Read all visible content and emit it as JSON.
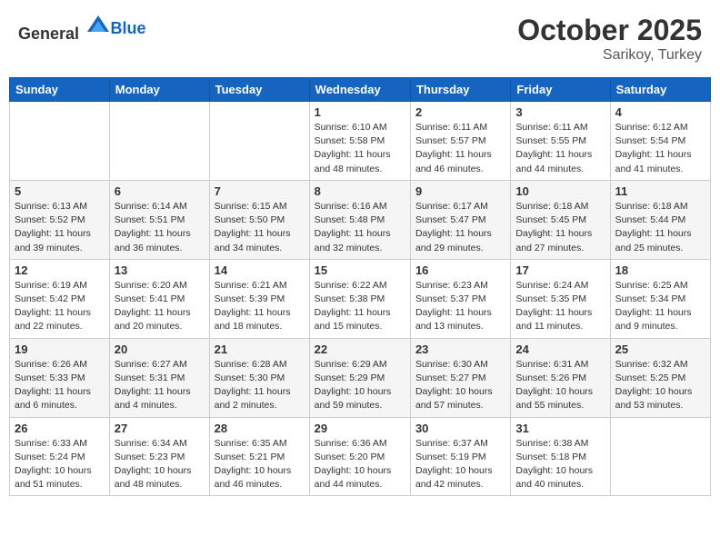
{
  "header": {
    "logo_general": "General",
    "logo_blue": "Blue",
    "month": "October 2025",
    "location": "Sarikoy, Turkey"
  },
  "days_of_week": [
    "Sunday",
    "Monday",
    "Tuesday",
    "Wednesday",
    "Thursday",
    "Friday",
    "Saturday"
  ],
  "weeks": [
    [
      {
        "day": "",
        "info": ""
      },
      {
        "day": "",
        "info": ""
      },
      {
        "day": "",
        "info": ""
      },
      {
        "day": "1",
        "info": "Sunrise: 6:10 AM\nSunset: 5:58 PM\nDaylight: 11 hours\nand 48 minutes."
      },
      {
        "day": "2",
        "info": "Sunrise: 6:11 AM\nSunset: 5:57 PM\nDaylight: 11 hours\nand 46 minutes."
      },
      {
        "day": "3",
        "info": "Sunrise: 6:11 AM\nSunset: 5:55 PM\nDaylight: 11 hours\nand 44 minutes."
      },
      {
        "day": "4",
        "info": "Sunrise: 6:12 AM\nSunset: 5:54 PM\nDaylight: 11 hours\nand 41 minutes."
      }
    ],
    [
      {
        "day": "5",
        "info": "Sunrise: 6:13 AM\nSunset: 5:52 PM\nDaylight: 11 hours\nand 39 minutes."
      },
      {
        "day": "6",
        "info": "Sunrise: 6:14 AM\nSunset: 5:51 PM\nDaylight: 11 hours\nand 36 minutes."
      },
      {
        "day": "7",
        "info": "Sunrise: 6:15 AM\nSunset: 5:50 PM\nDaylight: 11 hours\nand 34 minutes."
      },
      {
        "day": "8",
        "info": "Sunrise: 6:16 AM\nSunset: 5:48 PM\nDaylight: 11 hours\nand 32 minutes."
      },
      {
        "day": "9",
        "info": "Sunrise: 6:17 AM\nSunset: 5:47 PM\nDaylight: 11 hours\nand 29 minutes."
      },
      {
        "day": "10",
        "info": "Sunrise: 6:18 AM\nSunset: 5:45 PM\nDaylight: 11 hours\nand 27 minutes."
      },
      {
        "day": "11",
        "info": "Sunrise: 6:18 AM\nSunset: 5:44 PM\nDaylight: 11 hours\nand 25 minutes."
      }
    ],
    [
      {
        "day": "12",
        "info": "Sunrise: 6:19 AM\nSunset: 5:42 PM\nDaylight: 11 hours\nand 22 minutes."
      },
      {
        "day": "13",
        "info": "Sunrise: 6:20 AM\nSunset: 5:41 PM\nDaylight: 11 hours\nand 20 minutes."
      },
      {
        "day": "14",
        "info": "Sunrise: 6:21 AM\nSunset: 5:39 PM\nDaylight: 11 hours\nand 18 minutes."
      },
      {
        "day": "15",
        "info": "Sunrise: 6:22 AM\nSunset: 5:38 PM\nDaylight: 11 hours\nand 15 minutes."
      },
      {
        "day": "16",
        "info": "Sunrise: 6:23 AM\nSunset: 5:37 PM\nDaylight: 11 hours\nand 13 minutes."
      },
      {
        "day": "17",
        "info": "Sunrise: 6:24 AM\nSunset: 5:35 PM\nDaylight: 11 hours\nand 11 minutes."
      },
      {
        "day": "18",
        "info": "Sunrise: 6:25 AM\nSunset: 5:34 PM\nDaylight: 11 hours\nand 9 minutes."
      }
    ],
    [
      {
        "day": "19",
        "info": "Sunrise: 6:26 AM\nSunset: 5:33 PM\nDaylight: 11 hours\nand 6 minutes."
      },
      {
        "day": "20",
        "info": "Sunrise: 6:27 AM\nSunset: 5:31 PM\nDaylight: 11 hours\nand 4 minutes."
      },
      {
        "day": "21",
        "info": "Sunrise: 6:28 AM\nSunset: 5:30 PM\nDaylight: 11 hours\nand 2 minutes."
      },
      {
        "day": "22",
        "info": "Sunrise: 6:29 AM\nSunset: 5:29 PM\nDaylight: 10 hours\nand 59 minutes."
      },
      {
        "day": "23",
        "info": "Sunrise: 6:30 AM\nSunset: 5:27 PM\nDaylight: 10 hours\nand 57 minutes."
      },
      {
        "day": "24",
        "info": "Sunrise: 6:31 AM\nSunset: 5:26 PM\nDaylight: 10 hours\nand 55 minutes."
      },
      {
        "day": "25",
        "info": "Sunrise: 6:32 AM\nSunset: 5:25 PM\nDaylight: 10 hours\nand 53 minutes."
      }
    ],
    [
      {
        "day": "26",
        "info": "Sunrise: 6:33 AM\nSunset: 5:24 PM\nDaylight: 10 hours\nand 51 minutes."
      },
      {
        "day": "27",
        "info": "Sunrise: 6:34 AM\nSunset: 5:23 PM\nDaylight: 10 hours\nand 48 minutes."
      },
      {
        "day": "28",
        "info": "Sunrise: 6:35 AM\nSunset: 5:21 PM\nDaylight: 10 hours\nand 46 minutes."
      },
      {
        "day": "29",
        "info": "Sunrise: 6:36 AM\nSunset: 5:20 PM\nDaylight: 10 hours\nand 44 minutes."
      },
      {
        "day": "30",
        "info": "Sunrise: 6:37 AM\nSunset: 5:19 PM\nDaylight: 10 hours\nand 42 minutes."
      },
      {
        "day": "31",
        "info": "Sunrise: 6:38 AM\nSunset: 5:18 PM\nDaylight: 10 hours\nand 40 minutes."
      },
      {
        "day": "",
        "info": ""
      }
    ]
  ]
}
